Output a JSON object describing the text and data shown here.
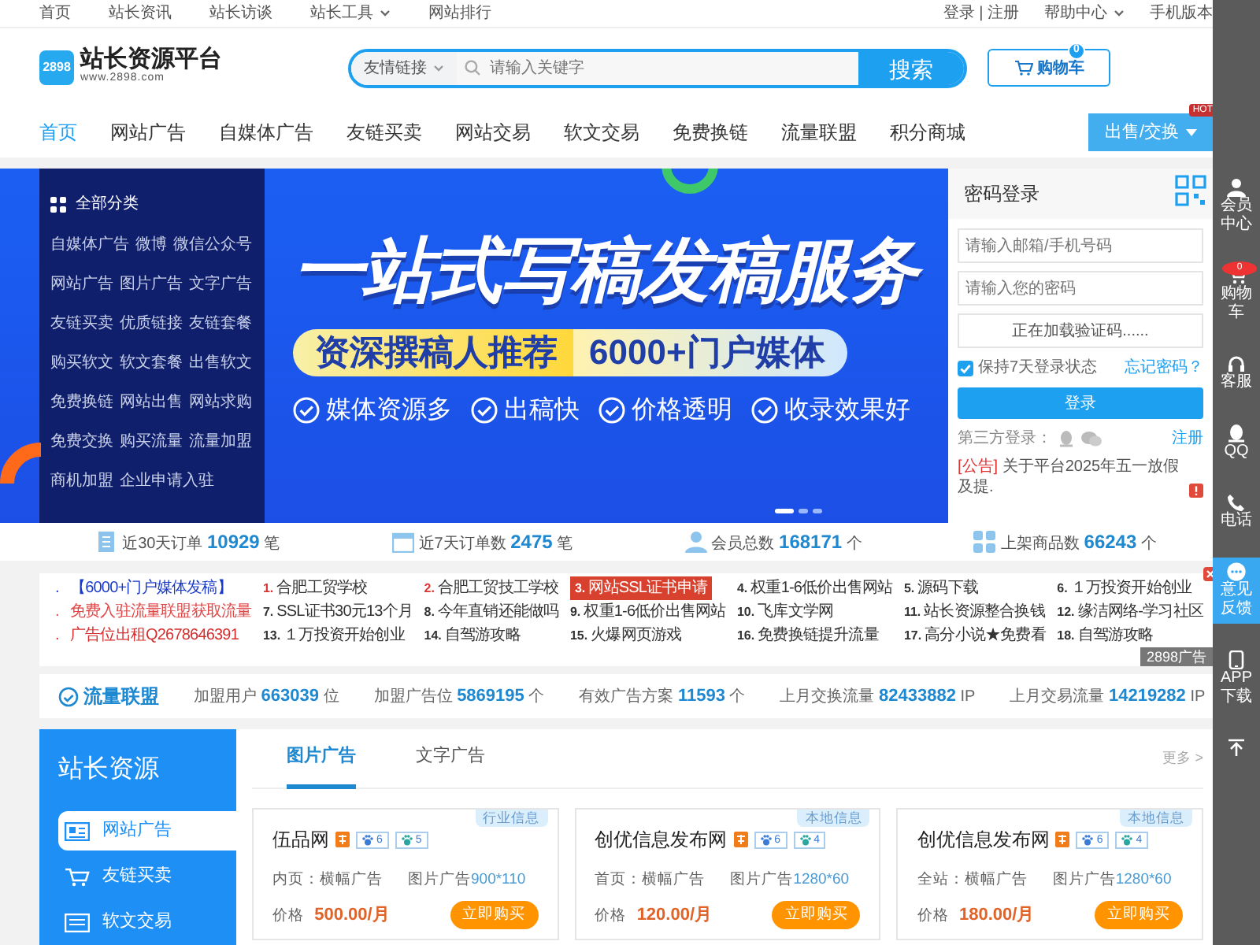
{
  "top_bar": {
    "left_links": [
      {
        "label": "首页",
        "dropdown": false
      },
      {
        "label": "站长资讯",
        "dropdown": false
      },
      {
        "label": "站长访谈",
        "dropdown": false
      },
      {
        "label": "站长工具",
        "dropdown": true
      },
      {
        "label": "网站排行",
        "dropdown": false
      }
    ],
    "right_links": [
      {
        "label": "登录 | 注册",
        "dropdown": false
      },
      {
        "label": "帮助中心",
        "dropdown": true
      },
      {
        "label": "手机版本",
        "dropdown": false
      }
    ]
  },
  "logo": {
    "mark": "2898",
    "name": "站长资源平台",
    "url": "www.2898.com"
  },
  "search": {
    "scope": "友情链接",
    "placeholder": "请输入关键字",
    "button": "搜索"
  },
  "cart": {
    "label": "购物车",
    "count": "0"
  },
  "nav": {
    "items": [
      {
        "label": "首页",
        "selected": true
      },
      {
        "label": "网站广告",
        "selected": false
      },
      {
        "label": "自媒体广告",
        "selected": false
      },
      {
        "label": "友链买卖",
        "selected": false
      },
      {
        "label": "网站交易",
        "selected": false
      },
      {
        "label": "软文交易",
        "selected": false
      },
      {
        "label": "免费换链",
        "selected": false
      },
      {
        "label": "流量联盟",
        "selected": false
      },
      {
        "label": "积分商城",
        "selected": false
      }
    ],
    "action": {
      "label": "出售/交换",
      "badge": "HOT"
    }
  },
  "categories": {
    "title": "全部分类",
    "rows": [
      [
        "自媒体广告",
        "微博",
        "微信公众号"
      ],
      [
        "网站广告",
        "图片广告",
        "文字广告"
      ],
      [
        "友链买卖",
        "优质链接",
        "友链套餐"
      ],
      [
        "购买软文",
        "软文套餐",
        "出售软文"
      ],
      [
        "免费换链",
        "网站出售",
        "网站求购"
      ],
      [
        "免费交换",
        "购买流量",
        "流量加盟"
      ],
      [
        "商机加盟",
        "企业申请入驻"
      ]
    ]
  },
  "banner": {
    "headline": "一站式写稿发稿服务",
    "tag": "资深撰稿人推荐",
    "highlight": "6000+门户媒体",
    "features": [
      "媒体资源多",
      "出稿快",
      "价格透明",
      "收录效果好"
    ],
    "dots": [
      {
        "selected": true
      },
      {
        "selected": false
      },
      {
        "selected": false
      }
    ]
  },
  "login": {
    "title": "密码登录",
    "account_placeholder": "请输入邮箱/手机号码",
    "password_placeholder": "请输入您的密码",
    "captcha": "正在加载验证码......",
    "remember": {
      "label": "保持7天登录状态",
      "checked": true
    },
    "forgot": "忘记密码？",
    "button": "登录",
    "third_party": "第三方登录：",
    "register": "注册",
    "notice": {
      "tag": "[公告]",
      "text": "关于平台2025年五一放假及提."
    }
  },
  "stats": [
    {
      "label": "近30天订单",
      "value": "10929",
      "unit": "笔"
    },
    {
      "label": "近7天订单数",
      "value": "2475",
      "unit": "笔"
    },
    {
      "label": "会员总数",
      "value": "168171",
      "unit": "个"
    },
    {
      "label": "上架商品数",
      "value": "66243",
      "unit": "个"
    }
  ],
  "ad_links": {
    "featured": [
      {
        "marker": ".",
        "text": "【6000+门户媒体发稿】",
        "color": "#1a3bc8"
      },
      {
        "marker": ".",
        "text": "免费入驻流量联盟获取流量",
        "color": "#e04848"
      },
      {
        "marker": ".",
        "text": "广告位出租Q2678646391",
        "color": "#d42e2e"
      }
    ],
    "ranked": [
      {
        "rank": "1.",
        "text": "合肥工贸学校",
        "hot": true,
        "highlighted": false
      },
      {
        "rank": "2.",
        "text": "合肥工贸技工学校",
        "hot": true,
        "highlighted": false
      },
      {
        "rank": "3.",
        "text": "网站SSL证书申请",
        "hot": true,
        "highlighted": true
      },
      {
        "rank": "4.",
        "text": "权重1-6低价出售网站",
        "hot": false,
        "highlighted": false
      },
      {
        "rank": "5.",
        "text": "源码下载",
        "hot": false,
        "highlighted": false
      },
      {
        "rank": "6.",
        "text": "１万投资开始创业",
        "hot": false,
        "highlighted": false
      },
      {
        "rank": "7.",
        "text": "SSL证书30元13个月",
        "hot": false,
        "highlighted": false
      },
      {
        "rank": "8.",
        "text": "今年直销还能做吗",
        "hot": false,
        "highlighted": false
      },
      {
        "rank": "9.",
        "text": "权重1-6低价出售网站",
        "hot": false,
        "highlighted": false
      },
      {
        "rank": "10.",
        "text": "飞库文学网",
        "hot": false,
        "highlighted": false
      },
      {
        "rank": "11.",
        "text": "站长资源整合换钱",
        "hot": false,
        "highlighted": false
      },
      {
        "rank": "12.",
        "text": "缘洁网络-学习社区",
        "hot": false,
        "highlighted": false
      },
      {
        "rank": "13.",
        "text": "１万投资开始创业",
        "hot": false,
        "highlighted": false
      },
      {
        "rank": "14.",
        "text": "自驾游攻略",
        "hot": false,
        "highlighted": false
      },
      {
        "rank": "15.",
        "text": "火爆网页游戏",
        "hot": false,
        "highlighted": false
      },
      {
        "rank": "16.",
        "text": "免费换链提升流量",
        "hot": false,
        "highlighted": false
      },
      {
        "rank": "17.",
        "text": "高分小说★免费看",
        "hot": false,
        "highlighted": false
      },
      {
        "rank": "18.",
        "text": "自驾游攻略",
        "hot": false,
        "highlighted": false
      }
    ],
    "tag": "2898广告"
  },
  "alliance": {
    "title": "流量联盟",
    "stats": [
      {
        "label": "加盟用户",
        "value": "663039",
        "unit": "位"
      },
      {
        "label": "加盟广告位",
        "value": "5869195",
        "unit": "个"
      },
      {
        "label": "有效广告方案",
        "value": "11593",
        "unit": "个"
      },
      {
        "label": "上月交换流量",
        "value": "82433882",
        "unit": "IP"
      },
      {
        "label": "上月交易流量",
        "value": "14219282",
        "unit": "IP"
      }
    ]
  },
  "resources": {
    "title": "站长资源",
    "menu": [
      {
        "label": "网站广告",
        "selected": true
      },
      {
        "label": "友链买卖",
        "selected": false
      },
      {
        "label": "软文交易",
        "selected": false
      }
    ],
    "tabs": [
      {
        "label": "图片广告",
        "selected": true
      },
      {
        "label": "文字广告",
        "selected": false
      }
    ],
    "more": "更多 >",
    "cards": [
      {
        "category": "行业信息",
        "name": "伍品网",
        "ratings": [
          "6",
          "5"
        ],
        "scope": "内页：",
        "ad_type": "横幅广告",
        "format": "图片广告",
        "size": "900*110",
        "price_label": "价格",
        "price": "500.00/月",
        "button": "立即购买"
      },
      {
        "category": "本地信息",
        "name": "创优信息发布网",
        "ratings": [
          "6",
          "4"
        ],
        "scope": "首页：",
        "ad_type": "横幅广告",
        "format": "图片广告",
        "size": "1280*60",
        "price_label": "价格",
        "price": "120.00/月",
        "button": "立即购买"
      },
      {
        "category": "本地信息",
        "name": "创优信息发布网",
        "ratings": [
          "6",
          "4"
        ],
        "scope": "全站：",
        "ad_type": "横幅广告",
        "format": "图片广告",
        "size": "1280*60",
        "price_label": "价格",
        "price": "180.00/月",
        "button": "立即购买"
      }
    ]
  },
  "side_rail": [
    {
      "label": "会员中心",
      "selected": false
    },
    {
      "label": "购物车",
      "badge": "0",
      "selected": false
    },
    {
      "label": "客服",
      "selected": false
    },
    {
      "label": "QQ",
      "selected": false
    },
    {
      "label": "电话",
      "selected": false
    },
    {
      "label": "意见反馈",
      "selected": true
    },
    {
      "label": "APP下载",
      "selected": false
    }
  ]
}
